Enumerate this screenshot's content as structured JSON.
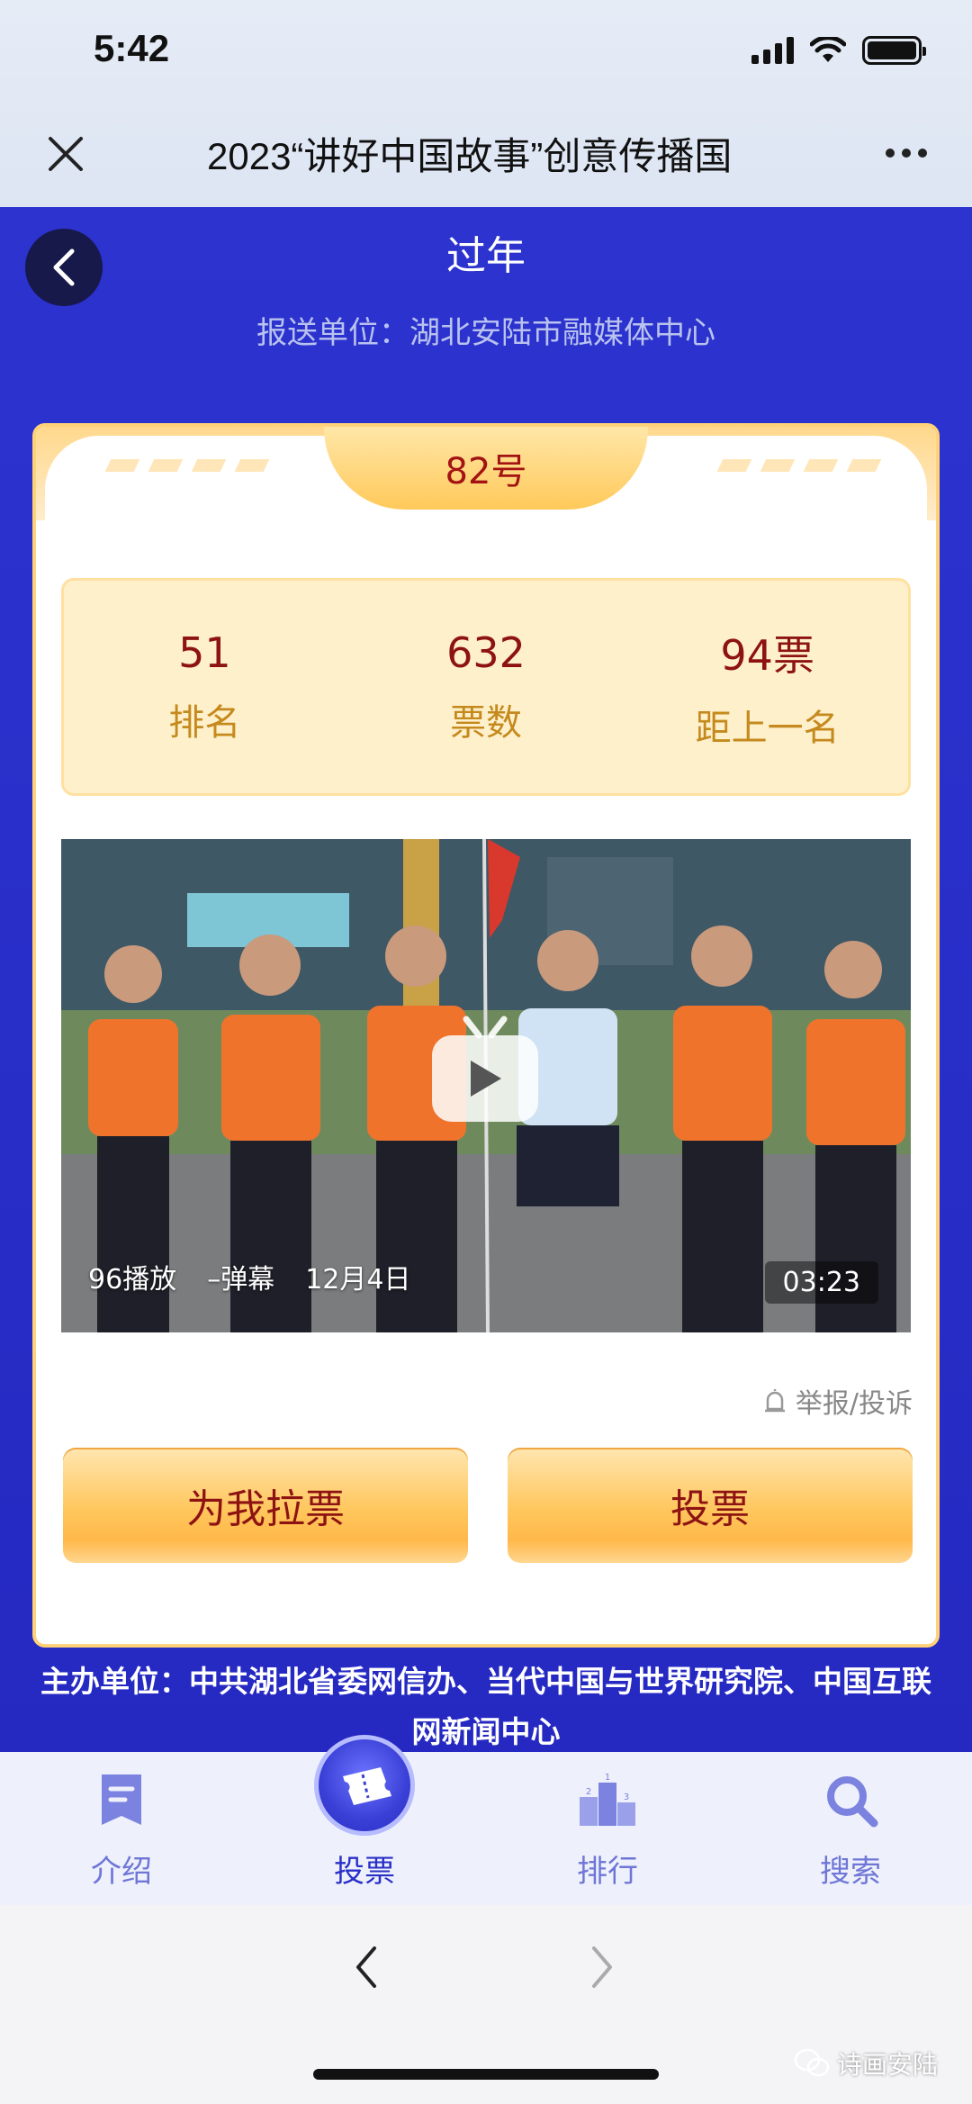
{
  "status_bar": {
    "time": "5:42"
  },
  "header": {
    "title": "2023“讲好中国故事”创意传播国"
  },
  "work": {
    "title": "过年",
    "submit_unit": "报送单位：湖北安陆市融媒体中心",
    "number": "82号"
  },
  "stats": [
    {
      "value": "51",
      "label": "排名"
    },
    {
      "value": "632",
      "label": "票数"
    },
    {
      "value": "94票",
      "label": "距上一名"
    }
  ],
  "video": {
    "plays": "96播放",
    "danmaku": "–弹幕",
    "date": "12月4日",
    "duration": "03:23"
  },
  "report_label": "举报/投诉",
  "buttons": {
    "canvass": "为我拉票",
    "vote": "投票"
  },
  "organizer": "主办单位：中共湖北省委网信办、当代中国与世界研究院、中国互联网新闻中心",
  "tabs": [
    {
      "label": "介绍",
      "icon": "intro-doc-icon"
    },
    {
      "label": "投票",
      "icon": "ticket-icon",
      "active": true
    },
    {
      "label": "排行",
      "icon": "podium-icon"
    },
    {
      "label": "搜索",
      "icon": "search-icon"
    }
  ],
  "watermark": "诗画安陆",
  "colors": {
    "primary_blue": "#2a30c7",
    "gold": "#ffc65c",
    "dark_red": "#8d1313"
  }
}
